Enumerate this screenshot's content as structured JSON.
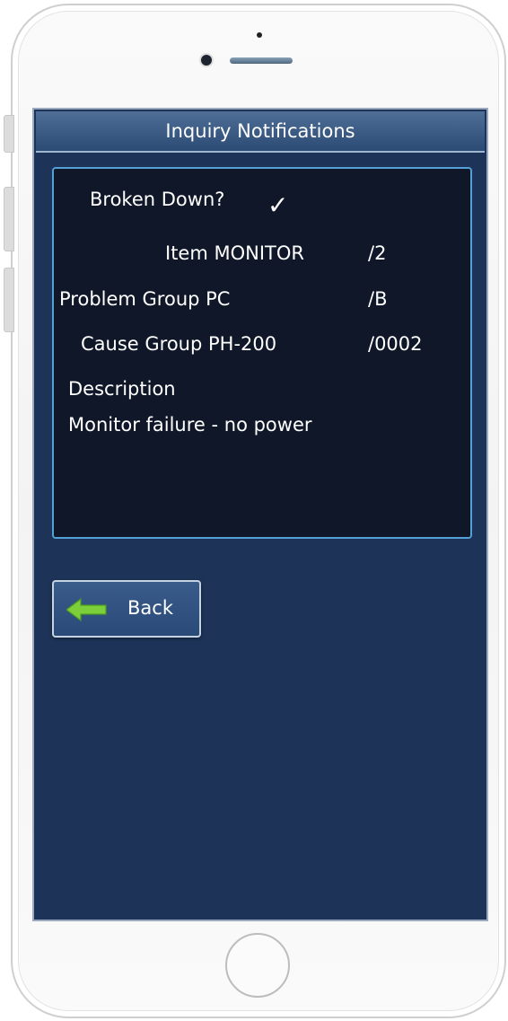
{
  "header": {
    "title": "Inquiry Notifications"
  },
  "notification": {
    "broken_down_label": "Broken Down?",
    "broken_down_checked": true,
    "check_glyph": "✓",
    "item_label": "Item MONITOR",
    "item_value": "/2",
    "problem_group_label": "Problem Group PC",
    "problem_group_value": "/B",
    "cause_group_label": "Cause Group PH-200",
    "cause_group_value": "/0002",
    "description_label": "Description",
    "description_value": "Monitor failure - no power"
  },
  "actions": {
    "back_label": "Back",
    "back_icon": "arrow-left-icon"
  },
  "colors": {
    "screen_bg": "#1d3357",
    "panel_bg": "#0f1728",
    "panel_border": "#53a0d6",
    "arrow_green": "#7ccf3a"
  }
}
